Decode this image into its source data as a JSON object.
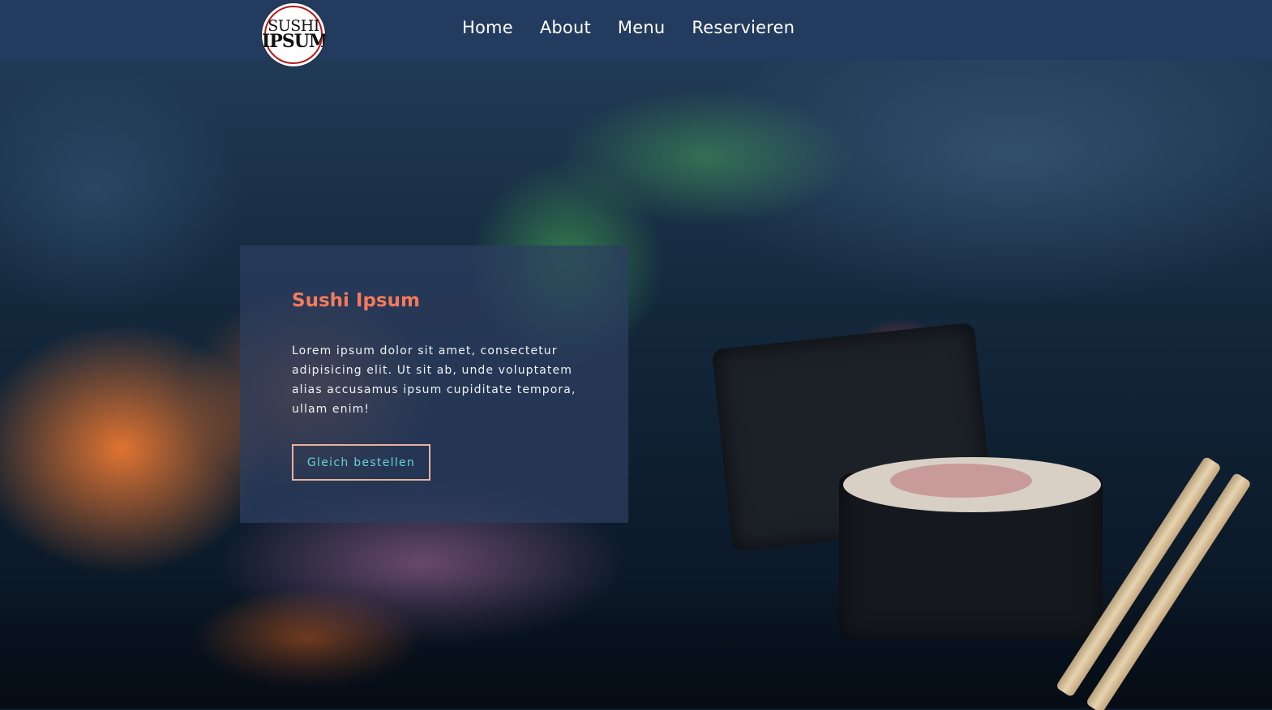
{
  "brand": {
    "logo_line_1": "SUSHI",
    "logo_line_2": "IPSUM"
  },
  "nav": {
    "items": [
      {
        "label": "Home"
      },
      {
        "label": "About"
      },
      {
        "label": "Menu"
      },
      {
        "label": "Reservieren"
      }
    ]
  },
  "hero": {
    "title": "Sushi Ipsum",
    "text": "Lorem ipsum dolor sit amet, consectetur adipisicing elit. Ut sit ab, unde voluptatem alias accusamus ipsum cupiditate tempora, ullam enim!",
    "button_label": "Gleich bestellen"
  },
  "colors": {
    "header_background": "#233b5e",
    "title_accent": "#f47a5c",
    "button_border": "#e8b19d",
    "button_text": "#6ad1d6"
  }
}
